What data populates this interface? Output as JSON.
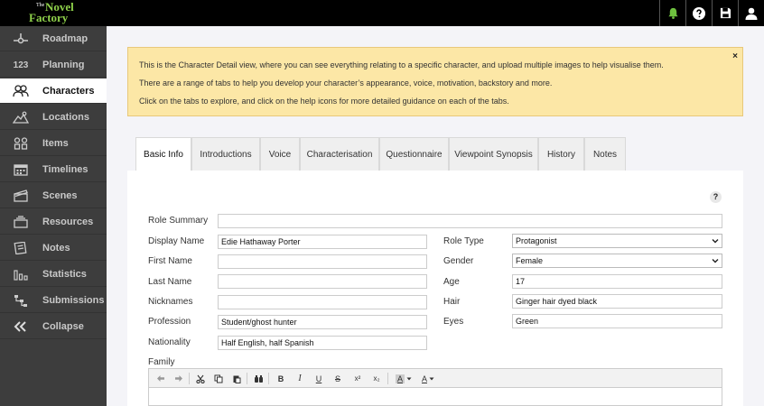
{
  "logo": {
    "the": "The",
    "novel": "Novel",
    "factory": "Factory"
  },
  "topbar": {
    "icons": [
      "bell-icon",
      "help-icon",
      "save-icon",
      "user-icon"
    ],
    "bell_color": "#6ec13f"
  },
  "sidebar": {
    "items": [
      {
        "label": "Roadmap",
        "icon": "roadmap-icon"
      },
      {
        "label": "Planning",
        "icon_text": "123"
      },
      {
        "label": "Characters",
        "icon": "characters-icon"
      },
      {
        "label": "Locations",
        "icon": "locations-icon"
      },
      {
        "label": "Items",
        "icon": "items-icon"
      },
      {
        "label": "Timelines",
        "icon": "calendar-icon"
      },
      {
        "label": "Scenes",
        "icon": "scenes-icon"
      },
      {
        "label": "Resources",
        "icon": "resources-icon"
      },
      {
        "label": "Notes",
        "icon": "notes-icon"
      },
      {
        "label": "Statistics",
        "icon": "statistics-icon"
      },
      {
        "label": "Submissions",
        "icon": "submissions-icon"
      },
      {
        "label": "Collapse",
        "icon": "collapse-icon"
      }
    ],
    "active": "Characters"
  },
  "alert": {
    "line1": "This is the Character Detail view, where you can see everything relating to a specific character, and upload multiple images to help visualise them.",
    "line2": "There are a range of tabs to help you develop your character’s appearance, voice, motivation, backstory and more.",
    "line3": "Click on the tabs to explore, and click on the help icons for more detailed guidance on each of the tabs.",
    "close": "×"
  },
  "tabs": [
    "Basic Info",
    "Introductions",
    "Voice",
    "Characterisation",
    "Questionnaire",
    "Viewpoint Synopsis",
    "History",
    "Notes"
  ],
  "form": {
    "help": "?",
    "role_summary": {
      "label": "Role Summary",
      "value": ""
    },
    "display_name": {
      "label": "Display Name",
      "value": "Edie Hathaway Porter"
    },
    "first_name": {
      "label": "First Name",
      "value": ""
    },
    "last_name": {
      "label": "Last Name",
      "value": ""
    },
    "nicknames": {
      "label": "Nicknames",
      "value": ""
    },
    "profession": {
      "label": "Profession",
      "value": "Student/ghost hunter"
    },
    "nationality": {
      "label": "Nationality",
      "value": "Half English, half Spanish"
    },
    "role_type": {
      "label": "Role Type",
      "value": "Protagonist"
    },
    "gender": {
      "label": "Gender",
      "value": "Female"
    },
    "age": {
      "label": "Age",
      "value": "17"
    },
    "hair": {
      "label": "Hair",
      "value": "Ginger hair dyed black"
    },
    "eyes": {
      "label": "Eyes",
      "value": "Green"
    },
    "family": {
      "label": "Family"
    }
  },
  "toolbar": {
    "bold": "B",
    "italic": "I",
    "underline": "U",
    "strike": "S",
    "superscript": "x²",
    "subscript": "x₂",
    "bg_color": "A",
    "text_color": "A"
  }
}
